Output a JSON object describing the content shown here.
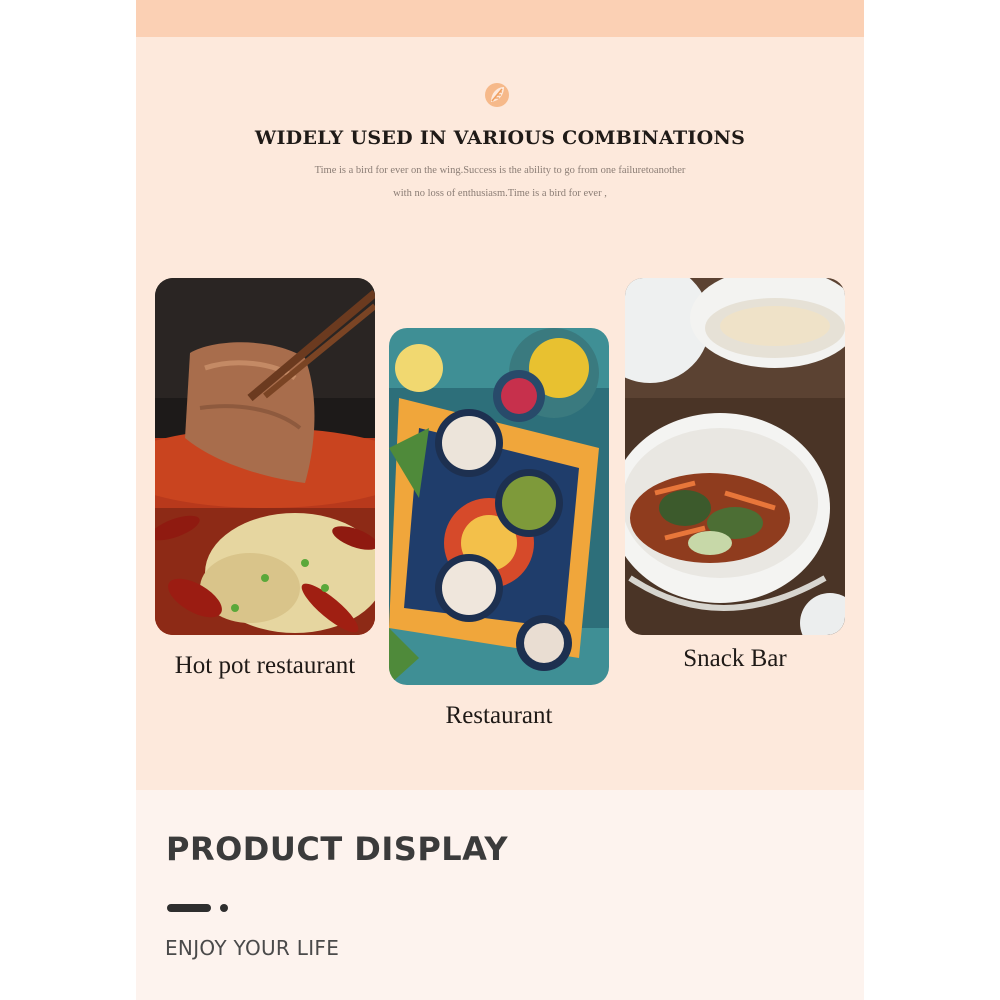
{
  "usage": {
    "icon": "leaf-icon",
    "title": "WIDELY USED IN VARIOUS COMBINATIONS",
    "subtitle_line1": "Time is a bird for ever on the wing.Success is the ability to go from one failuretoanother",
    "subtitle_line2": "with no loss of enthusiasm.Time is a bird for ever ,",
    "cards": [
      {
        "caption": "Hot pot restaurant"
      },
      {
        "caption": "Restaurant"
      },
      {
        "caption": "Snack Bar"
      }
    ]
  },
  "product_display": {
    "title": "PRODUCT DISPLAY",
    "subtitle": "ENJOY YOUR LIFE"
  },
  "colors": {
    "top_band": "#fbd0b4",
    "usage_background": "#fde9dc",
    "display_background": "#fdf3ee",
    "icon_accent": "#f0a060"
  }
}
